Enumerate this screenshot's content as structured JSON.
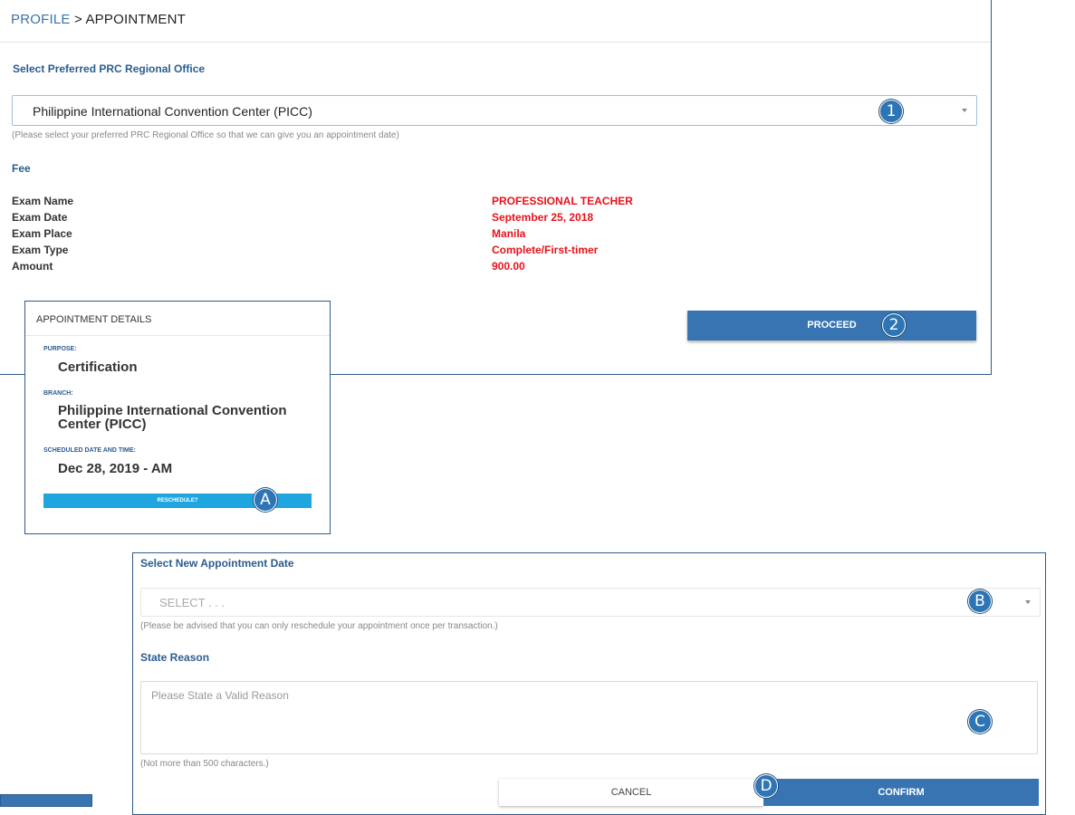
{
  "breadcrumb": {
    "parent": "PROFILE",
    "separator": " > ",
    "current": "APPOINTMENT"
  },
  "office_section": {
    "label": "Select Preferred PRC Regional Office",
    "selected": "Philippine International Convention Center (PICC)",
    "hint": "(Please select your preferred PRC Regional Office so that we can give you an appointment date)"
  },
  "fee": {
    "heading": "Fee",
    "rows": [
      {
        "label": "Exam Name",
        "value": "PROFESSIONAL TEACHER"
      },
      {
        "label": "Exam Date",
        "value": "September 25, 2018"
      },
      {
        "label": "Exam Place",
        "value": "Manila"
      },
      {
        "label": "Exam Type",
        "value": "Complete/First-timer"
      },
      {
        "label": "Amount",
        "value": "900.00"
      }
    ]
  },
  "proceed_label": "PROCEED",
  "markers": {
    "one": "1",
    "two": "2",
    "a": "A",
    "b": "B",
    "c": "C",
    "d": "D"
  },
  "appointment_card": {
    "title": "APPOINTMENT DETAILS",
    "purpose_label": "PURPOSE:",
    "purpose": "Certification",
    "branch_label": "BRANCH:",
    "branch": "Philippine International Convention Center (PICC)",
    "schedule_label": "SCHEDULED DATE AND TIME:",
    "schedule": "Dec 28, 2019 - AM",
    "reschedule_label": "RESCHEDULE?"
  },
  "reschedule_form": {
    "date_label": "Select New Appointment Date",
    "date_placeholder": "SELECT . . .",
    "date_hint": "(Please be advised that you can only reschedule your appointment once per transaction.)",
    "reason_label": "State Reason",
    "reason_placeholder": "Please State a Valid Reason",
    "reason_hint": "(Not more than 500 characters.)",
    "cancel_label": "CANCEL",
    "confirm_label": "CONFIRM"
  },
  "colors": {
    "accent_blue": "#3874b2",
    "heading_blue": "#2b5c8f",
    "value_red": "#e8121b",
    "reschedule_cyan": "#1fa6df",
    "marker_blue": "#2e75b6"
  }
}
